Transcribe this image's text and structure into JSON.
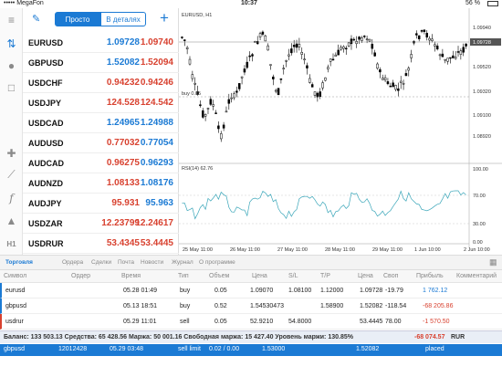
{
  "status": {
    "carrier": "••••• MegaFon",
    "time": "10:37",
    "battery": "56 %"
  },
  "quotes": {
    "tab_simple": "Просто",
    "tab_details": "В деталях",
    "add": "+",
    "rows": [
      {
        "symbol": "EURUSD",
        "bid": "1.09728",
        "ask": "1.09740",
        "bid_color": "blue",
        "ask_color": "red"
      },
      {
        "symbol": "GBPUSD",
        "bid": "1.52082",
        "ask": "1.52094",
        "bid_color": "blue",
        "ask_color": "red"
      },
      {
        "symbol": "USDCHF",
        "bid": "0.94232",
        "ask": "0.94246",
        "bid_color": "red",
        "ask_color": "red"
      },
      {
        "symbol": "USDJPY",
        "bid": "124.528",
        "ask": "124.542",
        "bid_color": "red",
        "ask_color": "red"
      },
      {
        "symbol": "USDCAD",
        "bid": "1.24965",
        "ask": "1.24988",
        "bid_color": "blue",
        "ask_color": "blue"
      },
      {
        "symbol": "AUDUSD",
        "bid": "0.77032",
        "ask": "0.77054",
        "bid_color": "red",
        "ask_color": "blue"
      },
      {
        "symbol": "AUDCAD",
        "bid": "0.96275",
        "ask": "0.96293",
        "bid_color": "red",
        "ask_color": "blue"
      },
      {
        "symbol": "AUDNZD",
        "bid": "1.08133",
        "ask": "1.08176",
        "bid_color": "red",
        "ask_color": "blue"
      },
      {
        "symbol": "AUDJPY",
        "bid": "95.931",
        "ask": "95.963",
        "bid_color": "red",
        "ask_color": "blue"
      },
      {
        "symbol": "USDZAR",
        "bid": "12.23799",
        "ask": "12.24617",
        "bid_color": "red",
        "ask_color": "red"
      },
      {
        "symbol": "USDRUR",
        "bid": "53.4345",
        "ask": "53.4445",
        "bid_color": "red",
        "ask_color": "red"
      }
    ]
  },
  "chart": {
    "title": "EURUSD, H1",
    "rsi_label": "RSI(14) 62.76",
    "buy_label": "buy 0.05",
    "price_badge": "1.09728",
    "price_ticks": [
      "1.09940",
      "1.09700",
      "1.09520",
      "1.09320",
      "1.09100",
      "1.08920"
    ],
    "rsi_ticks": [
      "100.00",
      "70.00",
      "30.00",
      "0.00"
    ],
    "time_ticks": [
      "25 May 11:00",
      "26 May 11:00",
      "27 May 11:00",
      "28 May 11:00",
      "29 May 11:00",
      "1 Jun 10:00",
      "2 Jun 10:00"
    ]
  },
  "tabs": [
    "Торговля",
    "Ордера",
    "Сделки",
    "Почта",
    "Новости",
    "Журнал",
    "О программе"
  ],
  "table": {
    "headers": [
      "Символ",
      "Ордер",
      "Время",
      "Тип",
      "Объем",
      "Цена",
      "S/L",
      "T/P",
      "Цена",
      "Своп",
      "Прибыль",
      "Комментарий"
    ],
    "rows": [
      {
        "symbol": "eurusd",
        "order": "",
        "time": "05.28 01:49",
        "type": "buy",
        "volume": "0.05",
        "price": "1.09070",
        "sl": "1.08100",
        "tp": "1.12000",
        "cur": "1.09728",
        "swap": "-19.79",
        "profit": "1 762.12",
        "profit_color": "blue"
      },
      {
        "symbol": "gbpusd",
        "order": "",
        "time": "05.13 18:51",
        "type": "buy",
        "volume": "0.52",
        "price": "1.54530473",
        "sl": "",
        "tp": "1.58900",
        "cur": "1.52082",
        "swap": "-118.54",
        "profit": "-68 205.86",
        "profit_color": "red"
      },
      {
        "symbol": "usdrur",
        "order": "",
        "time": "05.29 11:01",
        "type": "sell",
        "volume": "0.05",
        "price": "52.9210",
        "sl": "54.8000",
        "tp": "",
        "cur": "53.4445",
        "swap": "78.00",
        "profit": "-1 570.50",
        "profit_color": "red"
      }
    ]
  },
  "balance": {
    "text": "Баланс: 133 503.13 Средства: 65 428.56 Маржа: 50 001.16 Свободная маржа: 15 427.40 Уровень маржи: 130.85%",
    "total": "-68 074.57",
    "currency": "RUR"
  },
  "pending": {
    "symbol": "gbpusd",
    "order": "12012428",
    "time": "05.29 03:48",
    "type": "sell limit",
    "volume": "0.02 / 0.00",
    "price": "1.53000",
    "cur": "1.52082",
    "status": "placed"
  }
}
